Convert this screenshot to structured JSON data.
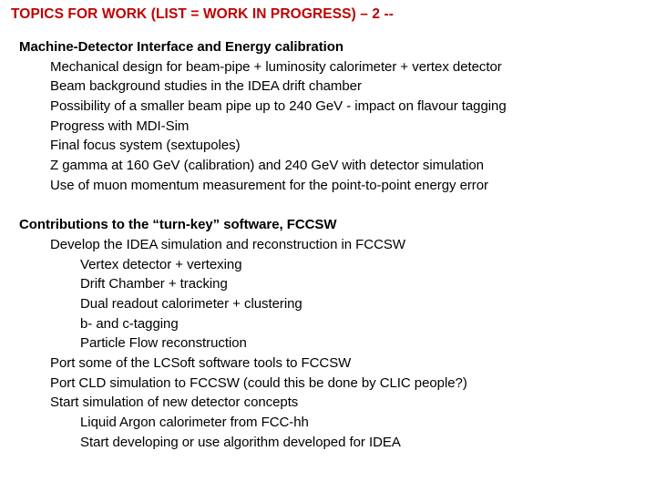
{
  "slide": {
    "title": "TOPICS FOR WORK (LIST = WORK IN PROGRESS) – 2 --",
    "title_color": "#C00000",
    "background_color": "#FFFFFF",
    "body_color": "#000000",
    "sections": [
      {
        "heading": "Machine-Detector Interface and Energy calibration",
        "items": [
          {
            "level": 2,
            "text": "Mechanical design for beam-pipe + luminosity calorimeter + vertex detector"
          },
          {
            "level": 2,
            "text": "Beam background studies in the IDEA drift chamber"
          },
          {
            "level": 2,
            "text": "Possibility of a smaller beam pipe up to 240 GeV - impact on flavour tagging"
          },
          {
            "level": 2,
            "text": "Progress with MDI-Sim"
          },
          {
            "level": 2,
            "text": "Final focus system (sextupoles)"
          },
          {
            "level": 2,
            "text": "Z gamma at 160 GeV (calibration) and 240 GeV with detector simulation"
          },
          {
            "level": 2,
            "text": "Use of muon momentum measurement for the point-to-point energy error"
          }
        ]
      },
      {
        "heading": "Contributions to the “turn-key” software, FCCSW",
        "items": [
          {
            "level": 2,
            "text": "Develop the IDEA simulation and reconstruction in FCCSW"
          },
          {
            "level": 3,
            "text": "Vertex detector + vertexing"
          },
          {
            "level": 3,
            "text": "Drift Chamber + tracking"
          },
          {
            "level": 3,
            "text": "Dual readout calorimeter + clustering"
          },
          {
            "level": 3,
            "text": "b- and c-tagging"
          },
          {
            "level": 3,
            "text": "Particle Flow reconstruction"
          },
          {
            "level": 2,
            "text": "Port some of the LCSoft software tools to FCCSW"
          },
          {
            "level": 2,
            "text": "Port CLD simulation to FCCSW (could this be done by CLIC people?)"
          },
          {
            "level": 2,
            "text": "Start simulation of new detector concepts"
          },
          {
            "level": 3,
            "text": "Liquid Argon calorimeter from FCC-hh"
          },
          {
            "level": 3,
            "text": "Start developing or use algorithm developed for IDEA"
          }
        ]
      }
    ]
  }
}
